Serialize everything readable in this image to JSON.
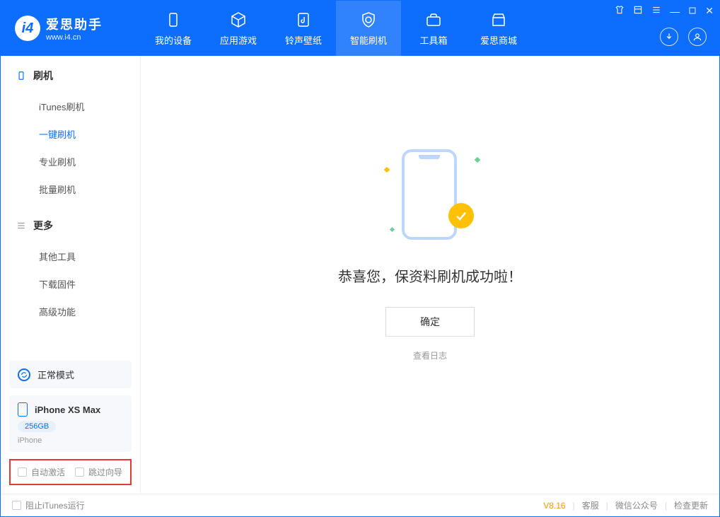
{
  "header": {
    "logo_title": "爱思助手",
    "logo_url": "www.i4.cn",
    "tabs": [
      {
        "label": "我的设备"
      },
      {
        "label": "应用游戏"
      },
      {
        "label": "铃声壁纸"
      },
      {
        "label": "智能刷机"
      },
      {
        "label": "工具箱"
      },
      {
        "label": "爱思商城"
      }
    ]
  },
  "sidebar": {
    "section1_title": "刷机",
    "section1_items": [
      "iTunes刷机",
      "一键刷机",
      "专业刷机",
      "批量刷机"
    ],
    "section2_title": "更多",
    "section2_items": [
      "其他工具",
      "下载固件",
      "高级功能"
    ],
    "mode_label": "正常模式",
    "device_name": "iPhone XS Max",
    "device_storage": "256GB",
    "device_type": "iPhone",
    "checkbox1": "自动激活",
    "checkbox2": "跳过向导"
  },
  "main": {
    "success_title": "恭喜您，保资料刷机成功啦！",
    "ok_button": "确定",
    "log_link": "查看日志"
  },
  "footer": {
    "block_itunes": "阻止iTunes运行",
    "version": "V8.16",
    "links": [
      "客服",
      "微信公众号",
      "检查更新"
    ]
  }
}
